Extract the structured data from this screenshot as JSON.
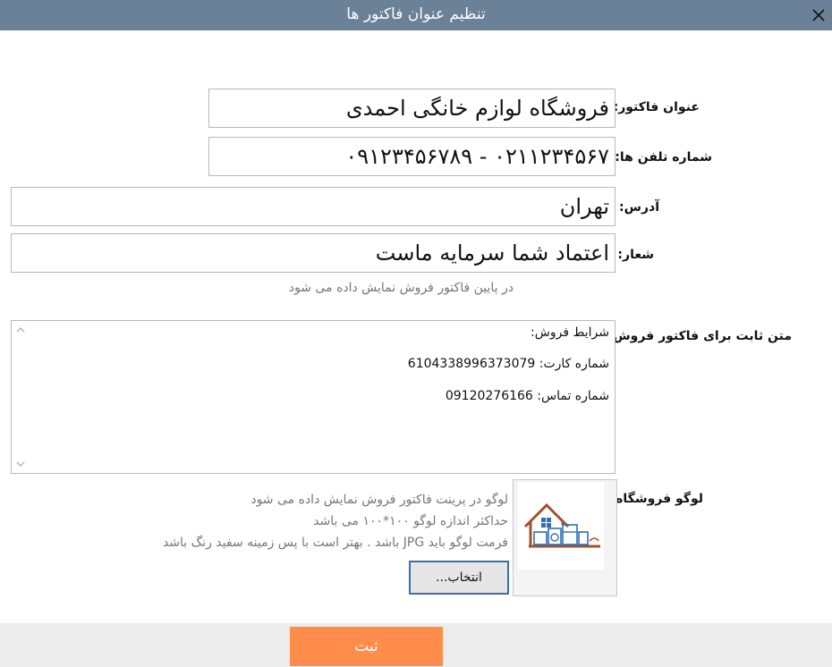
{
  "window": {
    "title": "تنظیم عنوان فاکتور ها",
    "close_icon": "close-icon"
  },
  "form": {
    "invoice_title_label": "عنوان فاکتور:",
    "invoice_title_value": "فروشگاه لوازم خانگی احمدی",
    "phones_label": "شماره تلفن ها:",
    "phones_value": "۰۲۱۱۲۳۴۵۶۷ - ۰۹۱۲۳۴۵۶۷۸۹",
    "address_label": "آدرس:",
    "address_value": "تهران",
    "slogan_label": "شعار:",
    "slogan_value": "اعتماد شما سرمایه ماست",
    "slogan_hint": "در پایین فاکتور فروش نمایش داده می شود",
    "fixed_text_label": "متن ثابت برای فاکتور فروش:",
    "fixed_text_lines": [
      "شرایط فروش:",
      "شماره کارت: 6104338996373079",
      "شماره تماس: 09120276166"
    ],
    "logo_label": "لوگو فروشگاه:",
    "logo_hint_lines": [
      "لوگو در پرینت فاکتور فروش نمایش داده می شود",
      "حداکثر اندازه لوگو ۱۰۰*۱۰۰ می باشد",
      "فرمت لوگو باید JPG باشد . بهتر است با پس زمینه سفید رنگ باشد"
    ],
    "choose_button_label": "انتخاب..."
  },
  "footer": {
    "submit_label": "ثبت"
  },
  "colors": {
    "titlebar": "#6b8198",
    "submit": "#ff8c4a",
    "logo_house": "#a0522d",
    "logo_appliance": "#2f6fb3"
  }
}
